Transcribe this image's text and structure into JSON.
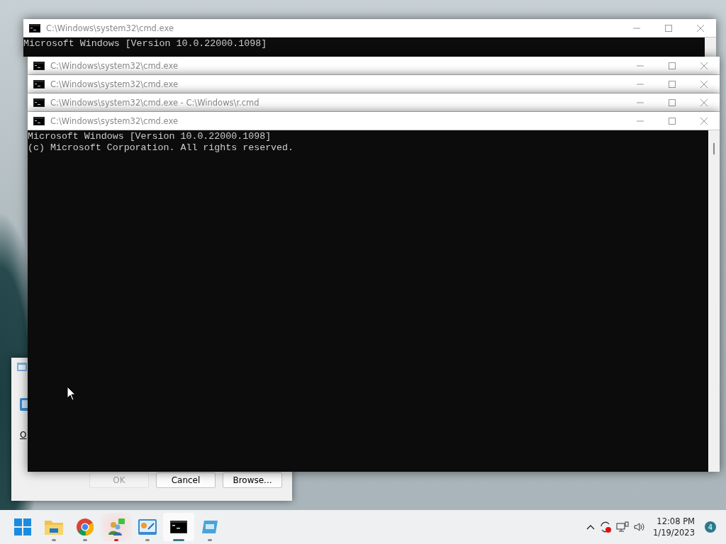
{
  "back_window": {
    "title": "C:\\Windows\\system32\\cmd.exe",
    "console_lines": [
      "Microsoft Windows [Version 10.0.22000.1098]"
    ]
  },
  "stacked_windows": [
    {
      "title": "C:\\Windows\\system32\\cmd.exe"
    },
    {
      "title": "C:\\Windows\\system32\\cmd.exe"
    },
    {
      "title": "C:\\Windows\\system32\\cmd.exe - C:\\Windows\\r.cmd"
    },
    {
      "title": "C:\\Windows\\system32\\cmd.exe"
    }
  ],
  "front_console": {
    "lines": [
      "Microsoft Windows [Version 10.0.22000.1098]",
      "(c) Microsoft Corporation. All rights reserved."
    ]
  },
  "dialog": {
    "label": "O",
    "buttons": [
      {
        "label": "OK",
        "disabled": true
      },
      {
        "label": "Cancel",
        "disabled": false
      },
      {
        "label": "Browse...",
        "disabled": false
      }
    ]
  },
  "taskbar": {
    "apps": [
      {
        "kind": "start",
        "running": false,
        "selected": false,
        "alert": false
      },
      {
        "kind": "folder",
        "running": true,
        "selected": false,
        "alert": false
      },
      {
        "kind": "browser",
        "running": true,
        "selected": false,
        "alert": false
      },
      {
        "kind": "network-app",
        "running": true,
        "selected": false,
        "alert": true
      },
      {
        "kind": "control-panel",
        "running": true,
        "selected": false,
        "alert": false
      },
      {
        "kind": "terminal",
        "running": true,
        "selected": true,
        "alert": false
      },
      {
        "kind": "monitor",
        "running": true,
        "selected": false,
        "alert": false
      }
    ],
    "tray": {
      "time": "12:08 PM",
      "date": "1/19/2023",
      "notifications": "4"
    }
  }
}
